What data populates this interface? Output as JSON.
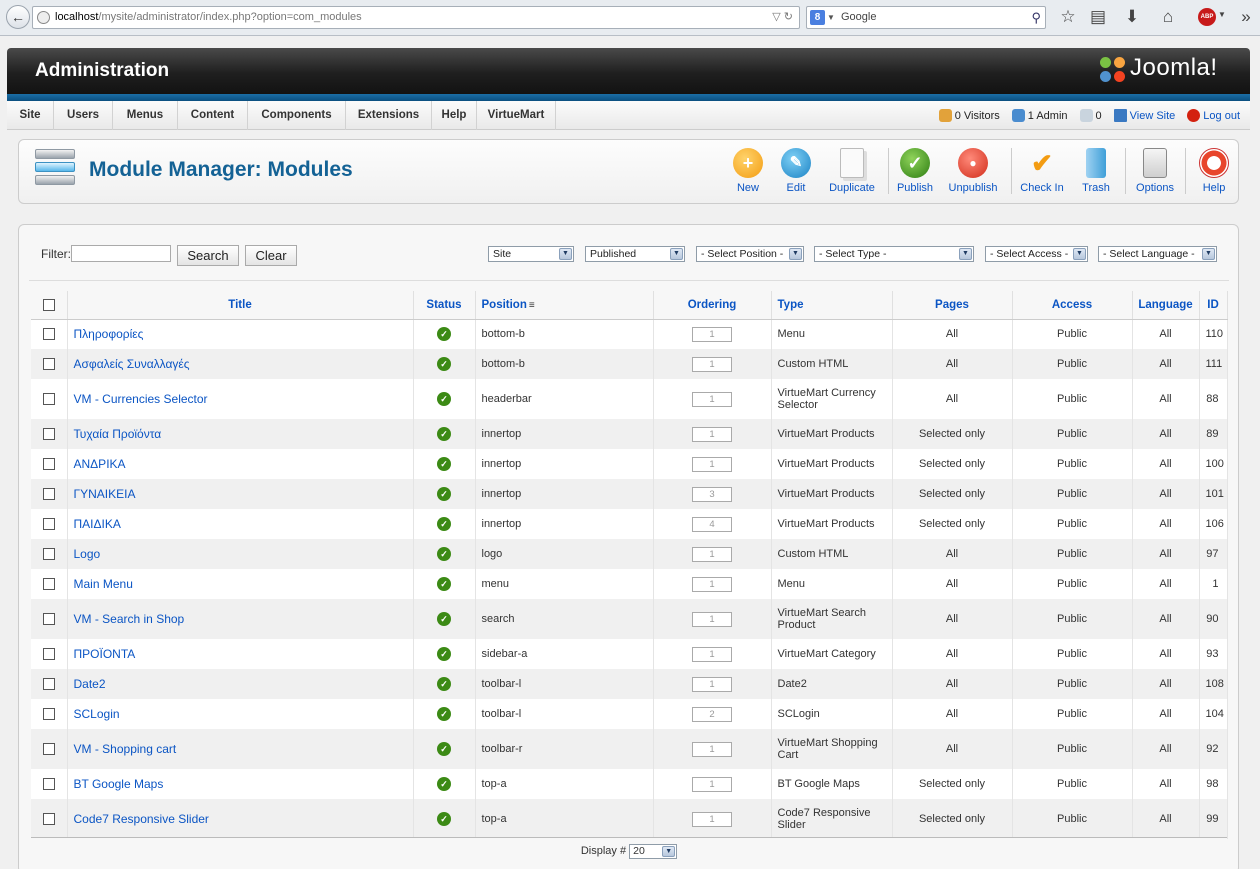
{
  "browser": {
    "url_host": "localhost",
    "url_path": "/mysite/administrator/index.php?option=com_modules",
    "search_placeholder": "Google",
    "g_badge": "8",
    "abp": "ABP"
  },
  "header": {
    "title": "Administration",
    "logo_text": "Joomla!"
  },
  "menu": {
    "items": [
      "Site",
      "Users",
      "Menus",
      "Content",
      "Components",
      "Extensions",
      "Help",
      "VirtueMart"
    ],
    "status": {
      "visitors": "0 Visitors",
      "admins": "1 Admin",
      "messages": "0",
      "view_site": "View Site",
      "logout": "Log out"
    }
  },
  "toolbar": {
    "title": "Module Manager: Modules",
    "buttons": {
      "new": "New",
      "edit": "Edit",
      "duplicate": "Duplicate",
      "publish": "Publish",
      "unpublish": "Unpublish",
      "checkin": "Check In",
      "trash": "Trash",
      "options": "Options",
      "help": "Help"
    }
  },
  "filters": {
    "label": "Filter:",
    "search_value": "",
    "search_btn": "Search",
    "clear_btn": "Clear",
    "site": "Site",
    "published": "Published",
    "position": "- Select Position -",
    "type": "- Select Type -",
    "access": "- Select Access -",
    "language": "- Select Language -"
  },
  "table": {
    "headers": {
      "title": "Title",
      "status": "Status",
      "position": "Position",
      "ordering": "Ordering",
      "type": "Type",
      "pages": "Pages",
      "access": "Access",
      "language": "Language",
      "id": "ID"
    },
    "rows": [
      {
        "title": "Πληροφορίες",
        "position": "bottom-b",
        "ordering": "1",
        "type": "Menu",
        "pages": "All",
        "access": "Public",
        "language": "All",
        "id": "110"
      },
      {
        "title": "Ασφαλείς Συναλλαγές",
        "position": "bottom-b",
        "ordering": "1",
        "type": "Custom HTML",
        "pages": "All",
        "access": "Public",
        "language": "All",
        "id": "111"
      },
      {
        "title": "VM - Currencies Selector",
        "position": "headerbar",
        "ordering": "1",
        "type": "VirtueMart Currency Selector",
        "pages": "All",
        "access": "Public",
        "language": "All",
        "id": "88"
      },
      {
        "title": "Τυχαία Προϊόντα",
        "position": "innertop",
        "ordering": "1",
        "type": "VirtueMart Products",
        "pages": "Selected only",
        "access": "Public",
        "language": "All",
        "id": "89"
      },
      {
        "title": "ΑΝΔΡΙΚΑ",
        "position": "innertop",
        "ordering": "1",
        "type": "VirtueMart Products",
        "pages": "Selected only",
        "access": "Public",
        "language": "All",
        "id": "100"
      },
      {
        "title": "ΓΥΝΑΙΚΕΙΑ",
        "position": "innertop",
        "ordering": "3",
        "type": "VirtueMart Products",
        "pages": "Selected only",
        "access": "Public",
        "language": "All",
        "id": "101"
      },
      {
        "title": "ΠΑΙΔΙΚΑ",
        "position": "innertop",
        "ordering": "4",
        "type": "VirtueMart Products",
        "pages": "Selected only",
        "access": "Public",
        "language": "All",
        "id": "106"
      },
      {
        "title": "Logo",
        "position": "logo",
        "ordering": "1",
        "type": "Custom HTML",
        "pages": "All",
        "access": "Public",
        "language": "All",
        "id": "97"
      },
      {
        "title": "Main Menu",
        "position": "menu",
        "ordering": "1",
        "type": "Menu",
        "pages": "All",
        "access": "Public",
        "language": "All",
        "id": "1"
      },
      {
        "title": "VM - Search in Shop",
        "position": "search",
        "ordering": "1",
        "type": "VirtueMart Search Product",
        "pages": "All",
        "access": "Public",
        "language": "All",
        "id": "90"
      },
      {
        "title": "ΠΡΟΪΟΝΤΑ",
        "position": "sidebar-a",
        "ordering": "1",
        "type": "VirtueMart Category",
        "pages": "All",
        "access": "Public",
        "language": "All",
        "id": "93"
      },
      {
        "title": "Date2",
        "position": "toolbar-l",
        "ordering": "1",
        "type": "Date2",
        "pages": "All",
        "access": "Public",
        "language": "All",
        "id": "108"
      },
      {
        "title": "SCLogin",
        "position": "toolbar-l",
        "ordering": "2",
        "type": "SCLogin",
        "pages": "All",
        "access": "Public",
        "language": "All",
        "id": "104"
      },
      {
        "title": "VM - Shopping cart",
        "position": "toolbar-r",
        "ordering": "1",
        "type": "VirtueMart Shopping Cart",
        "pages": "All",
        "access": "Public",
        "language": "All",
        "id": "92"
      },
      {
        "title": "BT Google Maps",
        "position": "top-a",
        "ordering": "1",
        "type": "BT Google Maps",
        "pages": "Selected only",
        "access": "Public",
        "language": "All",
        "id": "98"
      },
      {
        "title": "Code7 Responsive Slider",
        "position": "top-a",
        "ordering": "1",
        "type": "Code7 Responsive Slider",
        "pages": "Selected only",
        "access": "Public",
        "language": "All",
        "id": "99"
      }
    ]
  },
  "footer": {
    "display_label": "Display #",
    "display_value": "20"
  },
  "colors": {
    "accent": "#0b55c4",
    "title": "#146295",
    "header": "#1f1f1f",
    "strip": "#0b4f80"
  }
}
